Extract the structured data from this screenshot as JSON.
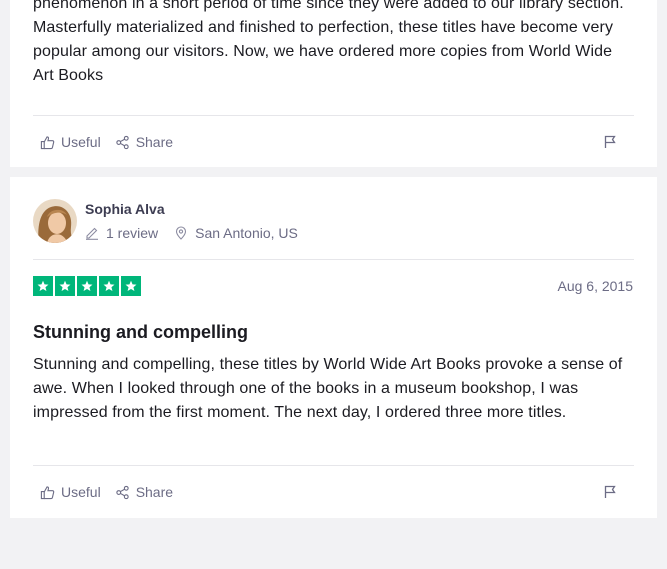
{
  "reviews": [
    {
      "body": "phenomenon in a short period of time since they were added to our library section. Masterfully materialized and finished to perfection, these titles have become very popular among our visitors. Now, we have ordered more copies from World Wide Art Books",
      "useful_label": "Useful",
      "share_label": "Share"
    },
    {
      "reviewer_name": "Sophia Alva",
      "review_count": "1 review",
      "location": "San Antonio, US",
      "rating": 5,
      "date": "Aug 6, 2015",
      "title": "Stunning and compelling",
      "body": "Stunning and compelling, these titles by World Wide Art Books provoke a sense of awe. When I looked through one of the books in a museum bookshop, I was impressed from the first moment. The next day, I ordered three more titles.",
      "useful_label": "Useful",
      "share_label": "Share"
    }
  ],
  "colors": {
    "star_green": "#00b67a",
    "muted_text": "#6c6c85",
    "page_background": "#f2f2f4"
  },
  "icons": [
    "thumbs-up-icon",
    "share-icon",
    "flag-icon",
    "pencil-icon",
    "location-pin-icon",
    "star-icon"
  ]
}
